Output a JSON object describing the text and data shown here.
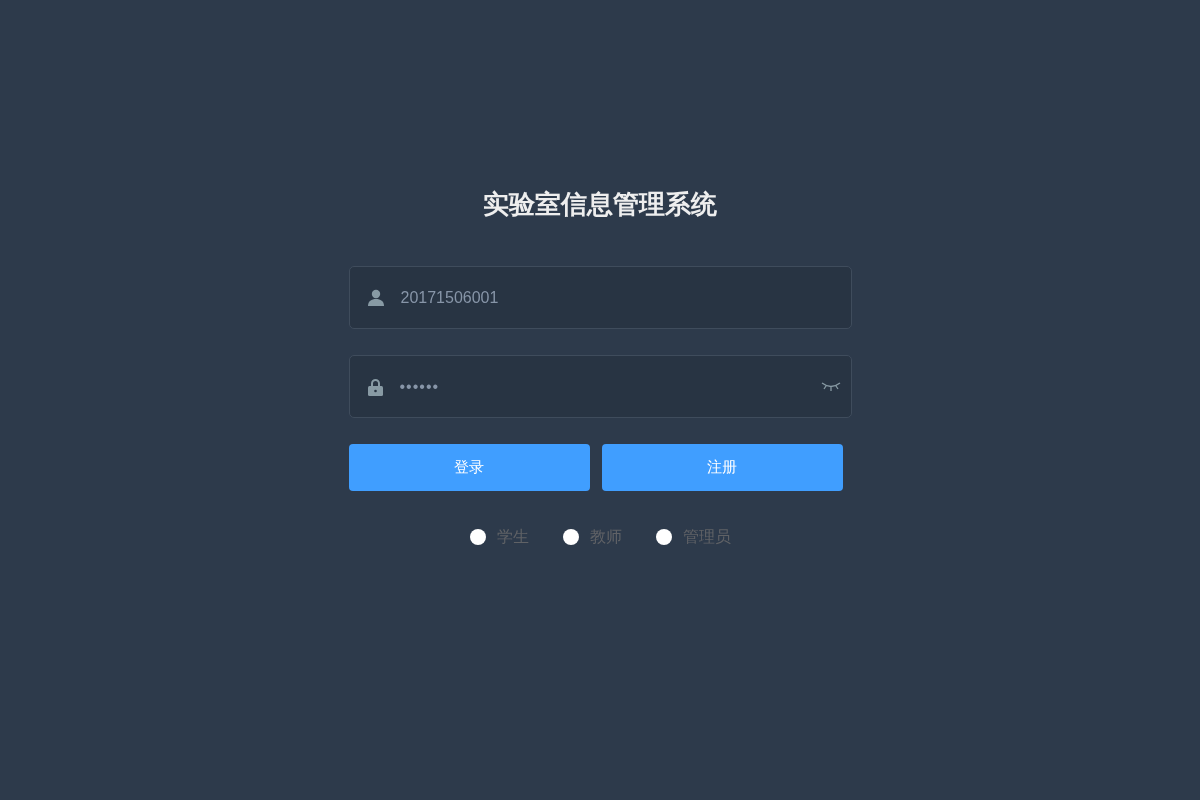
{
  "title": "实验室信息管理系统",
  "username": {
    "value": "20171506001"
  },
  "password": {
    "value": "••••••",
    "visible": false
  },
  "buttons": [
    {
      "label": "登录"
    },
    {
      "label": "注册"
    }
  ],
  "roles": [
    {
      "label": "学生",
      "selected": false
    },
    {
      "label": "教师",
      "selected": false
    },
    {
      "label": "管理员",
      "selected": false
    }
  ]
}
